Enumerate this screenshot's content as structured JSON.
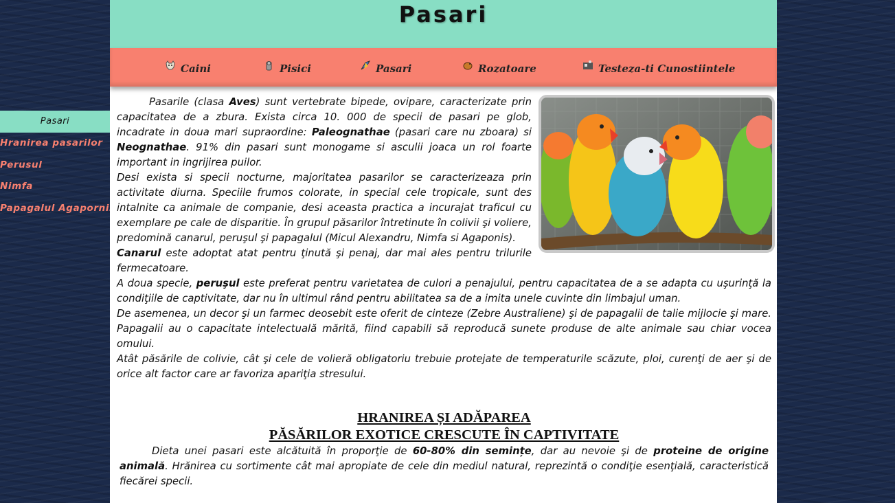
{
  "header": {
    "title": "Pasari"
  },
  "nav": [
    {
      "label": "Caini",
      "icon": "dog-icon"
    },
    {
      "label": "Pisici",
      "icon": "cat-icon"
    },
    {
      "label": "Pasari",
      "icon": "bird-icon"
    },
    {
      "label": "Rozatoare",
      "icon": "rodent-icon"
    },
    {
      "label": "Testeza-ti Cunostiintele",
      "icon": "quiz-icon"
    }
  ],
  "sidebar": {
    "title": "Pasari",
    "items": [
      "Hranirea pasarilor",
      "Perusul",
      "Nimfa",
      "Papagalul Agapornis"
    ]
  },
  "intro": {
    "p1_a": "Pasarile (clasa ",
    "p1_aves": "Aves",
    "p1_b": ") sunt vertebrate bipede, ovipare, caracterizate prin capacitatea de a zbura. Exista circa 10. 000 de specii de pasari pe glob, incadrate in doua mari supraordine: ",
    "p1_paleo": "Paleognathae",
    "p1_c": " (pasari care nu zboara) si ",
    "p1_neo": "Neognathae",
    "p1_d": ". 91% din pasari sunt monogame si asculii joaca un rol foarte important in ingrijirea puilor.",
    "p2": "Desi exista si specii nocturne, majoritatea pasarilor se caracterizeaza prin activitate diurna. Speciile frumos colorate, in special cele tropicale, sunt des intalnite ca animale de companie, desi aceasta practica a incurajat traficul cu exemplare pe cale de disparitie. În grupul păsarilor întretinute în colivii şi voliere, predomină canarul, peruşul şi papagalul (Micul Alexandru, Nimfa si Agaponis).",
    "p3_canar": "Canarul",
    "p3_rest": " este adoptat atat pentru ţinută şi penaj, dar mai ales pentru trilurile fermecatoare.",
    "p4_a": "A doua specie, ",
    "p4_perus": "peruşul",
    "p4_b": " este preferat pentru varietatea de culori a penajului, pentru capacitatea de a se adapta cu uşurinţă la condiţiile de captivitate, dar nu în ultimul rând pentru abilitatea sa de a imita unele cuvinte din limbajul uman.",
    "p5": "De asemenea, un decor şi un farmec deosebit este oferit de cinteze (Zebre Australiene) şi de papagalii de talie mijlocie şi mare. Papagalii au o capacitate intelectuală mărită, fiind capabili să reproducă sunete produse de alte animale sau chiar vocea omului.",
    "p6": "Atât păsările de colivie, cât şi cele de volieră obligatoriu trebuie protejate de temperaturile scăzute, ploi, curenţi de aer şi de orice alt factor care ar favoriza apariţia stresului."
  },
  "section": {
    "title_line1": "HRANIREA ȘI ADĂPAREA",
    "title_line2": "PĂSĂRILOR EXOTICE CRESCUTE ÎN CAPTIVITATE",
    "p_a": "Dieta unei pasari este alcătuită în proporţie de ",
    "p_b": "60-80% din semințe",
    "p_c": ", dar au nevoie şi de ",
    "p_d": "proteine de origine animală",
    "p_e": ". Hrănirea cu sortimente cât mai apropiate de cele din mediul natural, reprezintă o condiţie esenţială, caracteristică fiecărei specii."
  },
  "colors": {
    "header_bg": "#88dec4",
    "nav_bg": "#f8806f",
    "sidebar_link": "#f8806f",
    "page_bg": "#1b2a4a"
  }
}
